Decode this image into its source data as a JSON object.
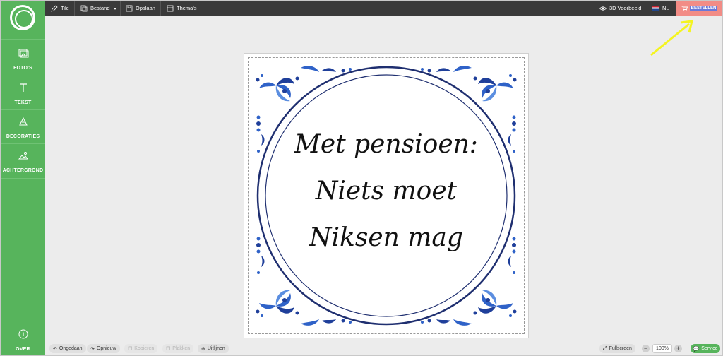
{
  "sidebar": {
    "items": [
      {
        "label": "FOTO'S",
        "icon": "photo-icon"
      },
      {
        "label": "TEKST",
        "icon": "text-icon"
      },
      {
        "label": "DECORATIES",
        "icon": "decorations-icon"
      },
      {
        "label": "ACHTERGROND",
        "icon": "background-icon"
      }
    ],
    "about": {
      "label": "OVER",
      "icon": "info-icon"
    }
  },
  "toolbar": {
    "tile": "Tile",
    "file": "Bestand",
    "save": "Opslaan",
    "themes": "Thema's",
    "preview": "3D Voorbeeld",
    "language": "NL",
    "order": "BESTELLEN"
  },
  "tile": {
    "lines": [
      "Met pensioen:",
      "Niets moet",
      "Niksen mag"
    ]
  },
  "bottombar": {
    "undo": "Ongedaan",
    "redo": "Opnieuw",
    "copy": "Kopieren",
    "paste": "Plakken",
    "align": "Uitlijnen",
    "fullscreen": "Fullscreen",
    "zoom": "100%",
    "service": "Service"
  },
  "colors": {
    "sidebar": "#57b45c",
    "toolbar": "#3a3a3a",
    "order": "#f28c86",
    "delft_blue": "#1f3f9a",
    "arrow": "#f4f420"
  }
}
